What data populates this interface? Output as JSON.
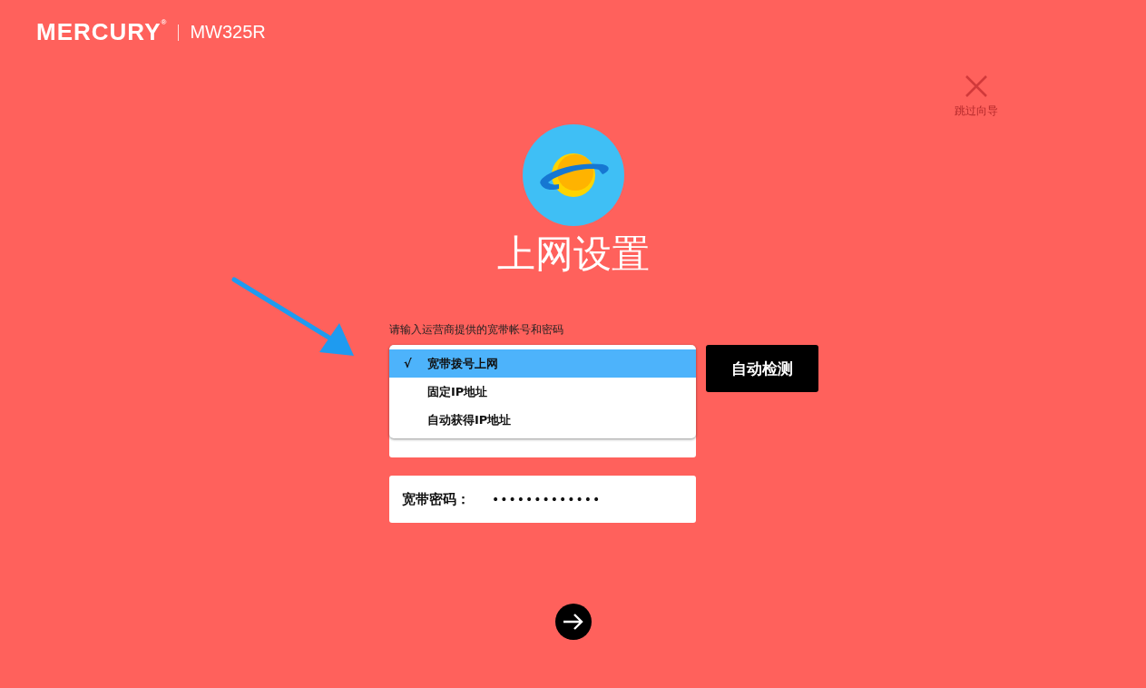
{
  "header": {
    "brand": "MERCURY$^{®}$",
    "model": "MW325R"
  },
  "skip": {
    "label": "跳过向导"
  },
  "title": "上网设置",
  "hint": "请输入运营商提供的宽带帐号和密码",
  "check_mark": "√",
  "connection_types": [
    {
      "label": "宽带拨号上网",
      "selected": true
    },
    {
      "label": "固定IP地址",
      "selected": false
    },
    {
      "label": "自动获得IP地址",
      "selected": false
    }
  ],
  "detect_button": "自动检测",
  "password": {
    "label": "宽带密码：",
    "value": "•••••••••••••"
  }
}
